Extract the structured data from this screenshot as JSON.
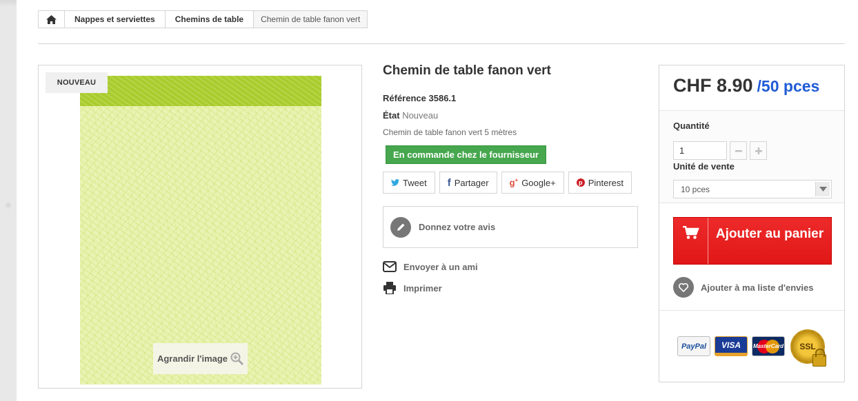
{
  "breadcrumb": {
    "home_icon": "home-icon",
    "items": [
      "Nappes et serviettes",
      "Chemins de table"
    ],
    "current": "Chemin de table fanon vert"
  },
  "image": {
    "badge": "NOUVEAU",
    "zoom_label": "Agrandir l'image",
    "zoom_icon": "zoom-in-icon"
  },
  "product": {
    "title": "Chemin de table fanon vert",
    "reference_label": "Référence",
    "reference_value": "3586.1",
    "state_label": "État",
    "state_value": "Nouveau",
    "description": "Chemin de table fanon vert 5 mètres",
    "availability": "En commande chez le fournisseur"
  },
  "social": {
    "tweet": "Tweet",
    "share": "Partager",
    "google": "Google+",
    "pinterest": "Pinterest"
  },
  "review": {
    "label": "Donnez votre avis"
  },
  "actions": {
    "send_friend": "Envoyer à un ami",
    "print": "Imprimer"
  },
  "buy": {
    "price": "CHF 8.90",
    "unit": "/50 pces",
    "quantity_label": "Quantité",
    "quantity_value": "1",
    "unit_label": "Unité de vente",
    "unit_selected": "10 pces",
    "add_to_cart": "Ajouter au panier",
    "wishlist": "Ajouter à ma liste d'envies"
  },
  "payment": {
    "paypal": "PayPal",
    "visa": "VISA",
    "mastercard": "MasterCard",
    "ssl": "SSL"
  },
  "colors": {
    "accent_blue": "#1f5bd6",
    "availability_green": "#46a74e",
    "cart_red": "#e11717",
    "product_green": "#a9cc2f"
  }
}
